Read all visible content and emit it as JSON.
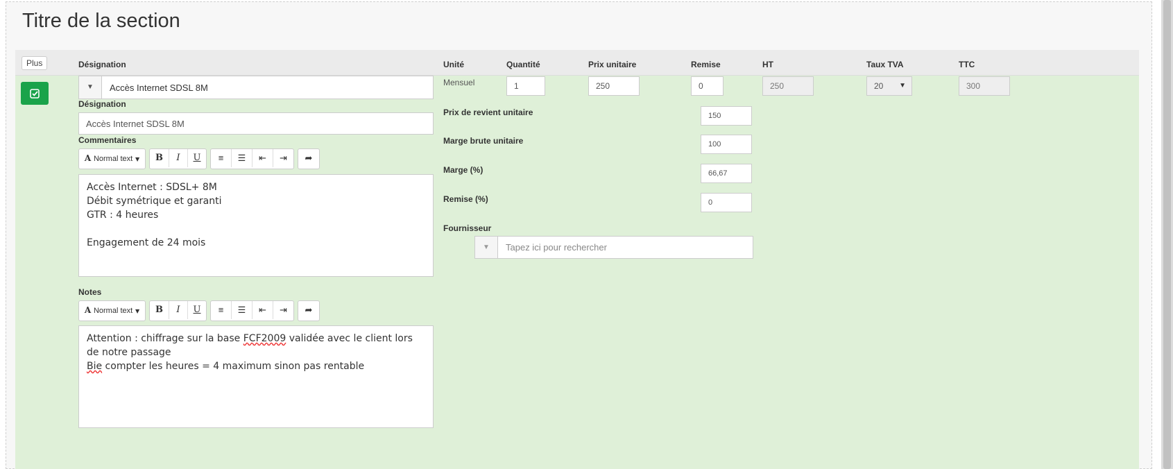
{
  "section": {
    "title": "Titre de la section"
  },
  "header": {
    "plus_label": "Plus",
    "columns": {
      "designation": "Désignation",
      "unite": "Unité",
      "quantite": "Quantité",
      "prix_unitaire": "Prix unitaire",
      "remise": "Remise",
      "ht": "HT",
      "taux_tva": "Taux TVA",
      "ttc": "TTC"
    }
  },
  "line": {
    "product_combo": "Accès Internet SDSL 8M",
    "unite": "Mensuel",
    "quantite": "1",
    "prix_unitaire": "250",
    "remise": "0",
    "ht": "250",
    "taux_tva": "20",
    "ttc": "300",
    "designation_label": "Désignation",
    "designation_value": "Accès Internet SDSL 8M",
    "commentaires_label": "Commentaires",
    "notes_label": "Notes",
    "commentaires_lines": [
      "Accès Internet : SDSL+ 8M",
      "Débit symétrique et garanti",
      "GTR : 4 heures",
      "",
      "Engagement de 24 mois"
    ],
    "notes": {
      "line1_a": "Attention : chiffrage sur la base ",
      "line1_spell": "FCF2009",
      "line1_b": " validée avec le client lors de notre passage",
      "line2_spell": "Bie",
      "line2_b": " compter les heures = 4 maximum sinon pas rentable"
    },
    "cost": {
      "prix_revient_label": "Prix de revient unitaire",
      "prix_revient_value": "150",
      "marge_brute_label": "Marge brute unitaire",
      "marge_brute_value": "100",
      "marge_pct_label": "Marge (%)",
      "marge_pct_value": "66,67",
      "remise_pct_label": "Remise (%)",
      "remise_pct_value": "0",
      "fournisseur_label": "Fournisseur",
      "fournisseur_placeholder": "Tapez ici pour rechercher"
    }
  },
  "toolbar": {
    "font_glyph": "A",
    "style_label": "Normal text",
    "bold": "B",
    "italic": "I",
    "underline": "U"
  },
  "colors": {
    "accent_green": "#1aa34a",
    "line_bg": "#dff0d8",
    "header_bg": "#ebebeb"
  }
}
